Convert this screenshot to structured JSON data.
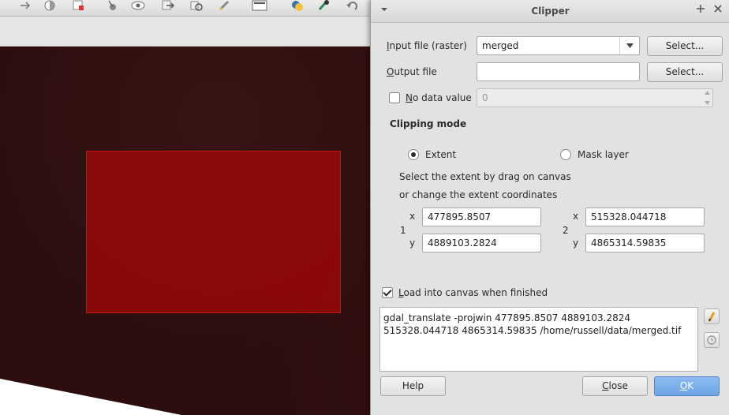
{
  "background_app": {
    "toolbar_icons": [
      "arrow-icon",
      "half-circle-icon",
      "new-layer-icon",
      "pin-icon",
      "eye-icon",
      "move-icon",
      "rotate-icon",
      "pencil-icon",
      "overview-icon",
      "python-icon",
      "tool-icon",
      "undo-icon"
    ]
  },
  "dialog": {
    "title": "Clipper",
    "input_file_label_u": "I",
    "input_file_label_rest": "nput file (raster)",
    "input_file_value": "merged",
    "input_select_label": "Select...",
    "output_file_label_u": "O",
    "output_file_label_rest": "utput file",
    "output_file_value": "",
    "output_select_label": "Select...",
    "no_data_label_u": "N",
    "no_data_label_rest": "o data value",
    "no_data_value": "0",
    "clipping_mode_heading": "Clipping mode",
    "mode_extent_label": "Extent",
    "mode_mask_label": "Mask layer",
    "instruction_line1": "Select the extent by drag on canvas",
    "instruction_line2": "or change the extent coordinates",
    "point1_label": "1",
    "point2_label": "2",
    "x_label": "x",
    "y_label": "y",
    "x1": "477895.8507",
    "y1": "4889103.2824",
    "x2": "515328.044718",
    "y2": "4865314.59835",
    "load_canvas_label_u": "L",
    "load_canvas_label_rest": "oad into canvas when finished",
    "command_text": "gdal_translate -projwin 477895.8507 4889103.2824 515328.044718 4865314.59835 /home/russell/data/merged.tif",
    "help_label": "Help",
    "close_label_u": "C",
    "close_label_rest": "lose",
    "ok_label_u": "O",
    "ok_label_rest": "K"
  },
  "colors": {
    "extent_fill": "#960808",
    "ok_button": "#6ea5e6",
    "canvas_bg": "#2c0e0e"
  }
}
